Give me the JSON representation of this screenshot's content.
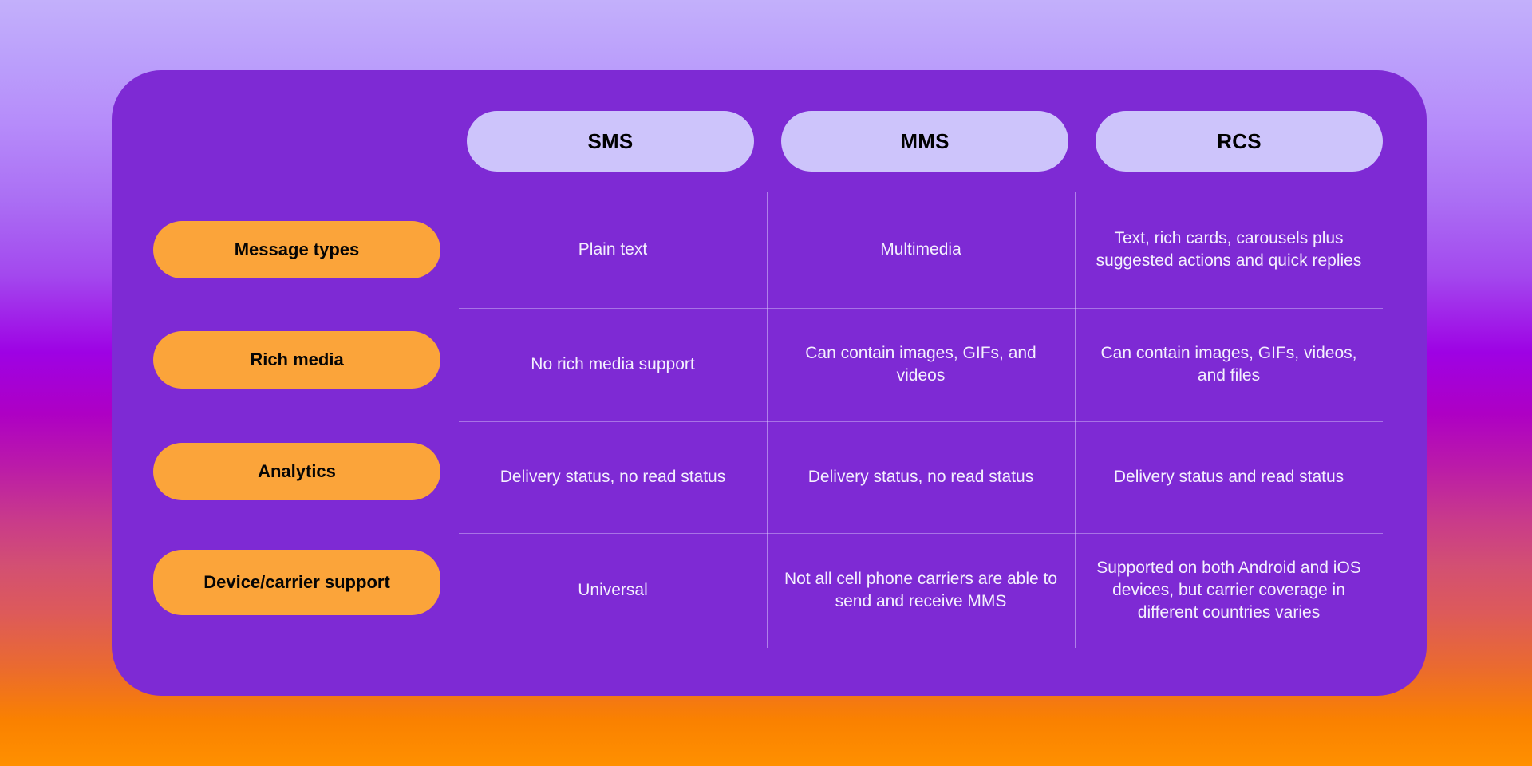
{
  "comparison_table": {
    "columns": [
      {
        "label": "SMS"
      },
      {
        "label": "MMS"
      },
      {
        "label": "RCS"
      }
    ],
    "rows": [
      {
        "label": "Message types",
        "cells": [
          "Plain text",
          "Multimedia",
          "Text, rich cards, carousels plus suggested actions and quick replies"
        ]
      },
      {
        "label": "Rich media",
        "cells": [
          "No rich media support",
          "Can contain images, GIFs, and videos",
          "Can contain images, GIFs, videos, and files"
        ]
      },
      {
        "label": "Analytics",
        "cells": [
          "Delivery status, no read status",
          "Delivery status, no read status",
          "Delivery status and read status"
        ]
      },
      {
        "label": "Device/carrier support",
        "cells": [
          "Universal",
          "Not all cell phone carriers are able to send and receive MMS",
          "Supported on both Android and iOS devices, but carrier coverage in different countries varies"
        ]
      }
    ]
  },
  "colors": {
    "card_background": "#7e2ad4",
    "column_pill": "#cdc4fb",
    "row_pill": "#fba43a",
    "cell_text": "#f4f0fe",
    "pill_text": "#000000",
    "gradient_top": "#c3b0fb",
    "gradient_mid": "#9e02e4",
    "gradient_bottom": "#ff9000"
  }
}
